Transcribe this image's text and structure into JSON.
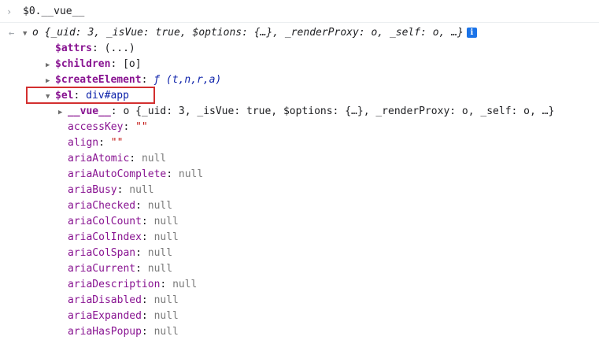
{
  "console": {
    "prompt_arrow": "›",
    "input": "$0.__vue__",
    "result_arrow": "←",
    "root_summary": "o {_uid: 3, _isVue: true, $options: {…}, _renderProxy: o, _self: o, …}",
    "info_icon": "i"
  },
  "tree": {
    "attrs_key": "$attrs",
    "attrs_value": "(...)",
    "children_key": "$children",
    "children_value": "[o]",
    "createElement_key": "$createElement",
    "createElement_value": "ƒ (t,n,r,a)",
    "el_key": "$el",
    "el_value": "div#app",
    "vue_key": "__vue__",
    "vue_value": "o {_uid: 3, _isVue: true, $options: {…}, _renderProxy: o, _self: o, …}"
  },
  "properties": [
    {
      "name": "accessKey",
      "value": "\"\""
    },
    {
      "name": "align",
      "value": "\"\""
    },
    {
      "name": "ariaAtomic",
      "value": "null"
    },
    {
      "name": "ariaAutoComplete",
      "value": "null"
    },
    {
      "name": "ariaBusy",
      "value": "null"
    },
    {
      "name": "ariaChecked",
      "value": "null"
    },
    {
      "name": "ariaColCount",
      "value": "null"
    },
    {
      "name": "ariaColIndex",
      "value": "null"
    },
    {
      "name": "ariaColSpan",
      "value": "null"
    },
    {
      "name": "ariaCurrent",
      "value": "null"
    },
    {
      "name": "ariaDescription",
      "value": "null"
    },
    {
      "name": "ariaDisabled",
      "value": "null"
    },
    {
      "name": "ariaExpanded",
      "value": "null"
    },
    {
      "name": "ariaHasPopup",
      "value": "null"
    }
  ]
}
